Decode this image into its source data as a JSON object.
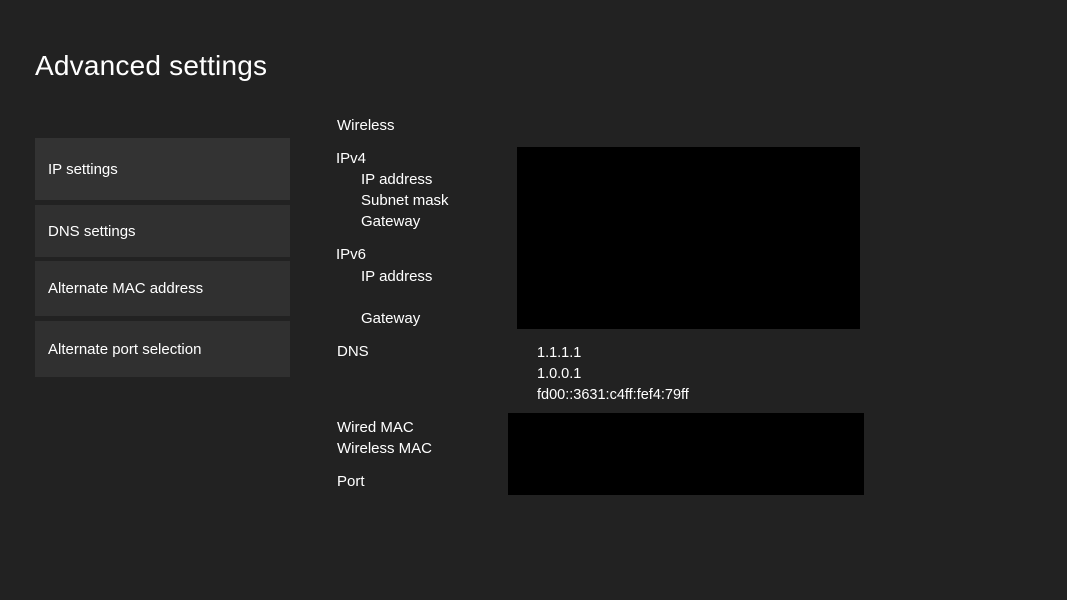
{
  "page": {
    "title": "Advanced settings"
  },
  "menu": {
    "items": [
      {
        "label": "IP settings",
        "selected": true
      },
      {
        "label": "DNS settings",
        "selected": false
      },
      {
        "label": "Alternate MAC address",
        "selected": false
      },
      {
        "label": "Alternate port selection",
        "selected": false
      }
    ]
  },
  "network": {
    "connection_type": "Wireless",
    "ipv4": {
      "heading": "IPv4",
      "ip_address_label": "IP address",
      "subnet_mask_label": "Subnet mask",
      "gateway_label": "Gateway"
    },
    "ipv6": {
      "heading": "IPv6",
      "ip_address_label": "IP address",
      "gateway_label": "Gateway"
    },
    "dns": {
      "label": "DNS",
      "values": [
        "1.1.1.1",
        "1.0.0.1",
        "fd00::3631:c4ff:fef4:79ff"
      ]
    },
    "wired_mac_label": "Wired MAC",
    "wireless_mac_label": "Wireless MAC",
    "port_label": "Port"
  },
  "colors": {
    "background": "#222222",
    "menu_item": "#303030",
    "redaction": "#000000",
    "text": "#ffffff"
  }
}
